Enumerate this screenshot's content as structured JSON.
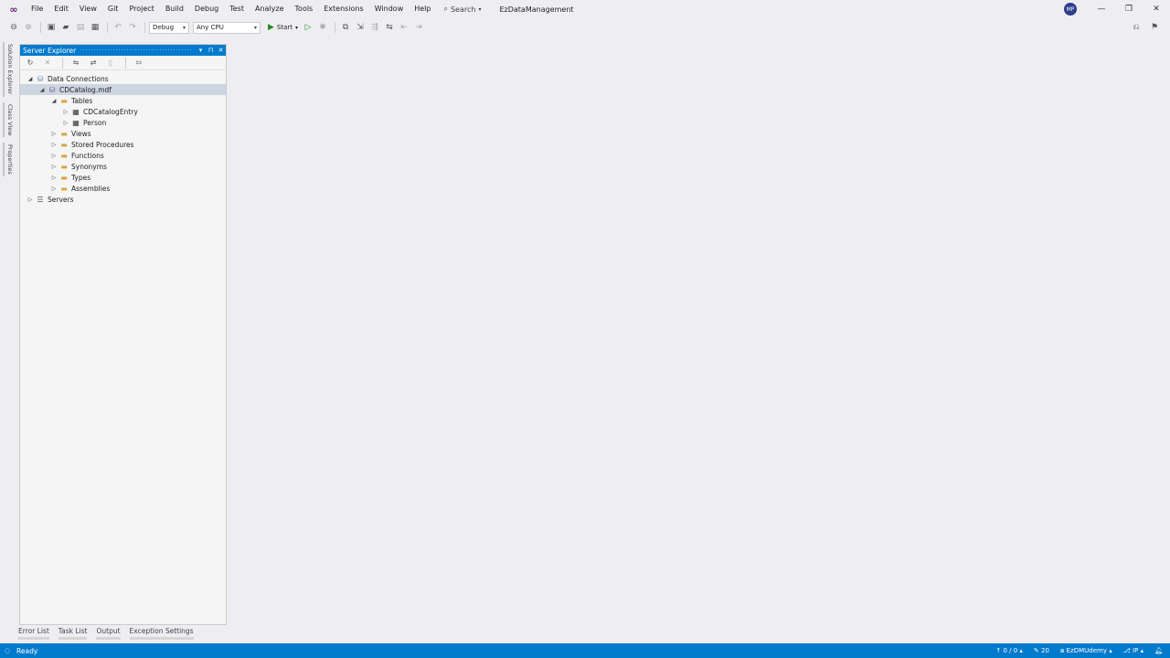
{
  "titlebar": {
    "logo_icon": "visual-studio-logo-icon",
    "menu": [
      "File",
      "Edit",
      "View",
      "Git",
      "Project",
      "Build",
      "Debug",
      "Test",
      "Analyze",
      "Tools",
      "Extensions",
      "Window",
      "Help"
    ],
    "search_label": "Search",
    "solution_name": "EzDataManagement",
    "avatar_initials": "MP"
  },
  "toolbar": {
    "config_value": "Debug",
    "platform_value": "Any CPU",
    "start_label": "Start"
  },
  "vertical_tabs": [
    "Solution Explorer",
    "Class View",
    "Properties"
  ],
  "server_explorer": {
    "title": "Server Explorer",
    "tree": [
      {
        "label": "Data Connections",
        "icon": "data-connections-icon",
        "level": 0,
        "expander": "◢"
      },
      {
        "label": "CDCatalog.mdf",
        "icon": "database-icon",
        "level": 1,
        "expander": "◢",
        "selected": true
      },
      {
        "label": "Tables",
        "icon": "folder-icon",
        "level": 2,
        "expander": "◢"
      },
      {
        "label": "CDCatalogEntry",
        "icon": "table-icon",
        "level": 3,
        "expander": "▷"
      },
      {
        "label": "Person",
        "icon": "table-icon",
        "level": 3,
        "expander": "▷"
      },
      {
        "label": "Views",
        "icon": "folder-icon",
        "level": 2,
        "expander": "▷"
      },
      {
        "label": "Stored Procedures",
        "icon": "folder-icon",
        "level": 2,
        "expander": "▷"
      },
      {
        "label": "Functions",
        "icon": "folder-icon",
        "level": 2,
        "expander": "▷"
      },
      {
        "label": "Synonyms",
        "icon": "folder-icon",
        "level": 2,
        "expander": "▷"
      },
      {
        "label": "Types",
        "icon": "folder-icon",
        "level": 2,
        "expander": "▷"
      },
      {
        "label": "Assemblies",
        "icon": "folder-icon",
        "level": 2,
        "expander": "▷"
      },
      {
        "label": "Servers",
        "icon": "servers-icon",
        "level": 0,
        "expander": "▷"
      }
    ]
  },
  "bottom_tabs": [
    "Error List",
    "Task List",
    "Output",
    "Exception Settings"
  ],
  "statusbar": {
    "status_text": "Ready",
    "line_col": "0 / 0",
    "changes": "20",
    "repo": "EzDMUdemy",
    "branch": "IP"
  },
  "colors": {
    "accent": "#007acc",
    "background": "#eeeef2",
    "panel_bg": "#f5f5f5",
    "selection": "#ccd5e0"
  }
}
